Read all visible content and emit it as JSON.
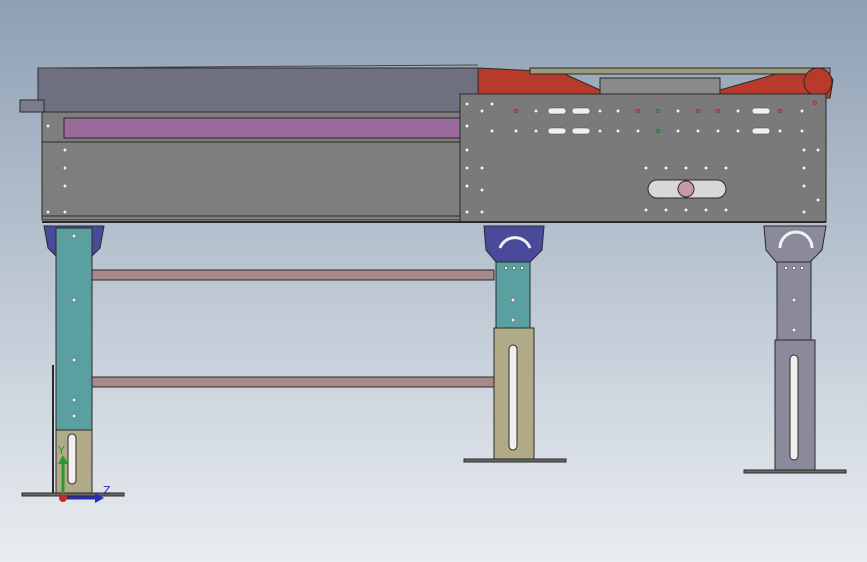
{
  "viewport": {
    "background_top": "#8fa0b4",
    "background_bottom": "#e9edf1"
  },
  "colors": {
    "frame_gray": "#7e7e7e",
    "frame_dark": "#5e5e5e",
    "outline": "#2a2a2a",
    "top_cover": "#6e7080",
    "purple_rail": "#9a6a9a",
    "red_guard": "#b83a2a",
    "leg_teal": "#5aa0a0",
    "leg_tan": "#b0aa88",
    "leg_gray": "#8a8a9a",
    "leg_bracket_blue": "#4a4a9a",
    "cross_bar": "#a88a8a",
    "hole_white": "#f0f0f0",
    "hole_red": "#c84a3a",
    "hole_green": "#3a9a3a"
  },
  "triad": {
    "axis_y_label": "Y",
    "axis_z_label": "Z",
    "axis_y_color": "#2a9a2a",
    "axis_z_color": "#2a2ab8",
    "origin_color": "#c82a2a"
  },
  "model": {
    "name_icon": "conveyor-frame-side-view"
  }
}
